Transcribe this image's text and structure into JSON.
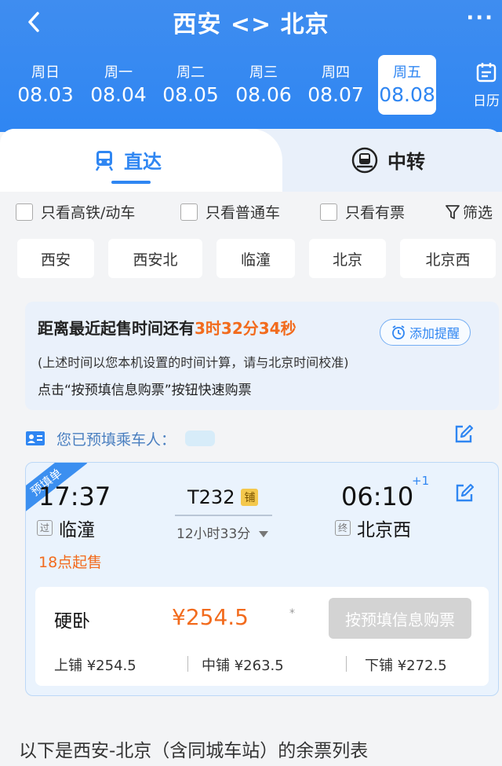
{
  "header": {
    "title": "西安 <> 北京",
    "more": "···",
    "calendar_label": "日历",
    "dates": [
      {
        "weekday": "周日",
        "date": "08.03",
        "active": false
      },
      {
        "weekday": "周一",
        "date": "08.04",
        "active": false
      },
      {
        "weekday": "周二",
        "date": "08.05",
        "active": false
      },
      {
        "weekday": "周三",
        "date": "08.06",
        "active": false
      },
      {
        "weekday": "周四",
        "date": "08.07",
        "active": false
      },
      {
        "weekday": "周五",
        "date": "08.08",
        "active": true
      }
    ]
  },
  "tabs": {
    "direct": "直达",
    "transfer": "中转"
  },
  "filters": {
    "high_speed": "只看高铁/动车",
    "normal": "只看普通车",
    "available": "只看有票",
    "screen": "筛选"
  },
  "stations": [
    "西安",
    "西安北",
    "临潼",
    "北京",
    "北京西"
  ],
  "countdown": {
    "prefix": "距离最近起售时间还有",
    "time": "3时32分34秒",
    "remind_button": "添加提醒",
    "note": "(上述时间以您本机设置的时间计算，请与北京时间校准)",
    "tip": "点击“按预填信息购票”按钮快速购票"
  },
  "passenger": {
    "label": "您已预填乘车人："
  },
  "ticket": {
    "ribbon": "预填单",
    "depart_time": "17:37",
    "depart_tag": "过",
    "depart_station": "临潼",
    "sale_time": "18点起售",
    "train_no": "T232",
    "berth_badge": "铺",
    "duration": "12小时33分",
    "arrive_time": "06:10",
    "plus_day": "+1",
    "arrive_tag": "终",
    "arrive_station": "北京西",
    "seat_type": "硬卧",
    "price": "¥254.5",
    "star": "*",
    "buy_button": "按预填信息购票",
    "berths": [
      "上铺 ¥254.5",
      "中铺 ¥263.5",
      "下铺 ¥272.5"
    ]
  },
  "footer": {
    "text": "以下是西安-北京（含同城车站）的余票列表"
  },
  "colors": {
    "brand_blue": "#2f86f2",
    "accent_orange": "#f26b1d"
  }
}
